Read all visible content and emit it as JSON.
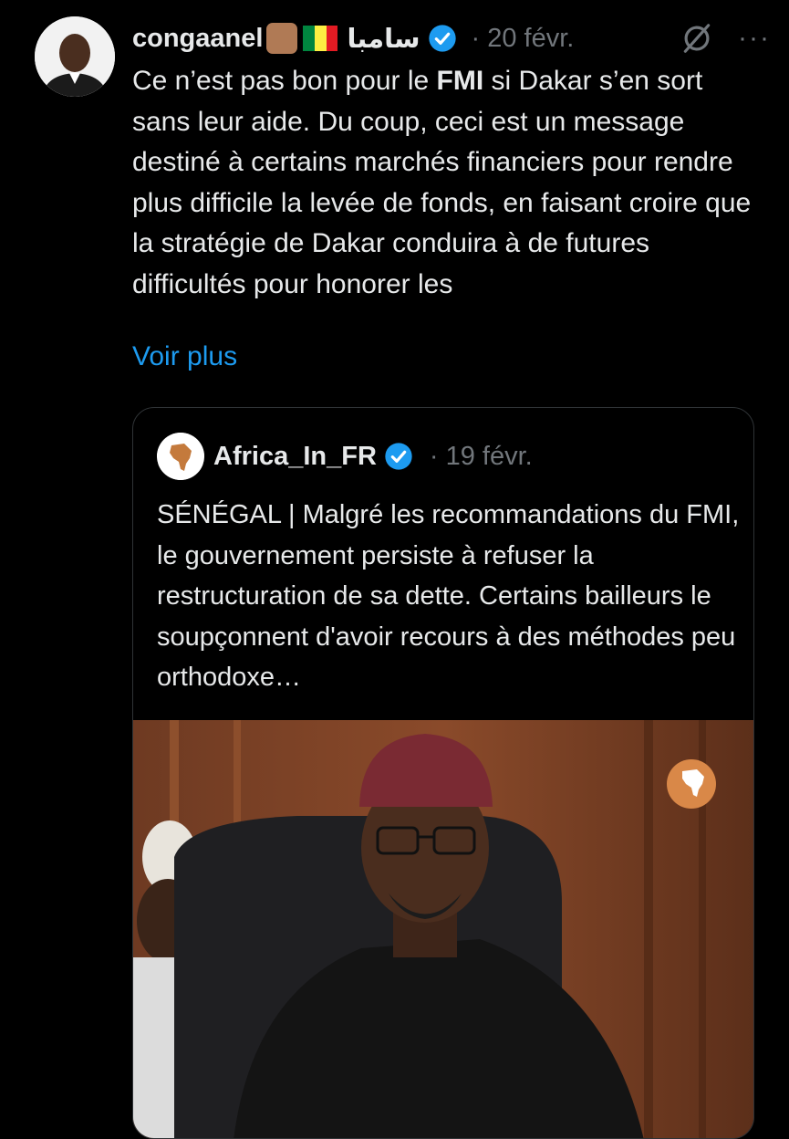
{
  "tweet": {
    "author_name": "congaanel",
    "author_arabic": "سامبا",
    "date": "· 20 févr.",
    "text_before_bold": "Ce n’est pas bon pour le ",
    "text_bold": "FMI",
    "text_after_bold": " si Dakar s’en sort sans leur aide. Du coup, ceci est un message destiné à certains marchés financiers pour rendre plus difficile la levée de fonds, en faisant croire que la stratégie de Dakar conduira à de futures difficultés pour honorer les",
    "see_more": "Voir plus",
    "more_icon_text": "···"
  },
  "quote": {
    "author_name": "Africa_In_FR",
    "date": "· 19 févr.",
    "text": "SÉNÉGAL | Malgré les recommandations du FMI, le gouvernement persiste à refuser la restructuration de sa dette. Certains bailleurs le soupçonnent d'avoir recours à des méthodes peu orthodoxe…"
  },
  "colors": {
    "background": "#000000",
    "text": "#e7e9ea",
    "muted": "#71767b",
    "link": "#1d9bf0",
    "verified": "#1d9bf0",
    "border": "#2f3336"
  },
  "icons": [
    "raised-fist-emoji-icon",
    "senegal-flag-icon",
    "verified-badge-icon",
    "grok-icon",
    "more-options-icon",
    "africa-logo-icon"
  ]
}
